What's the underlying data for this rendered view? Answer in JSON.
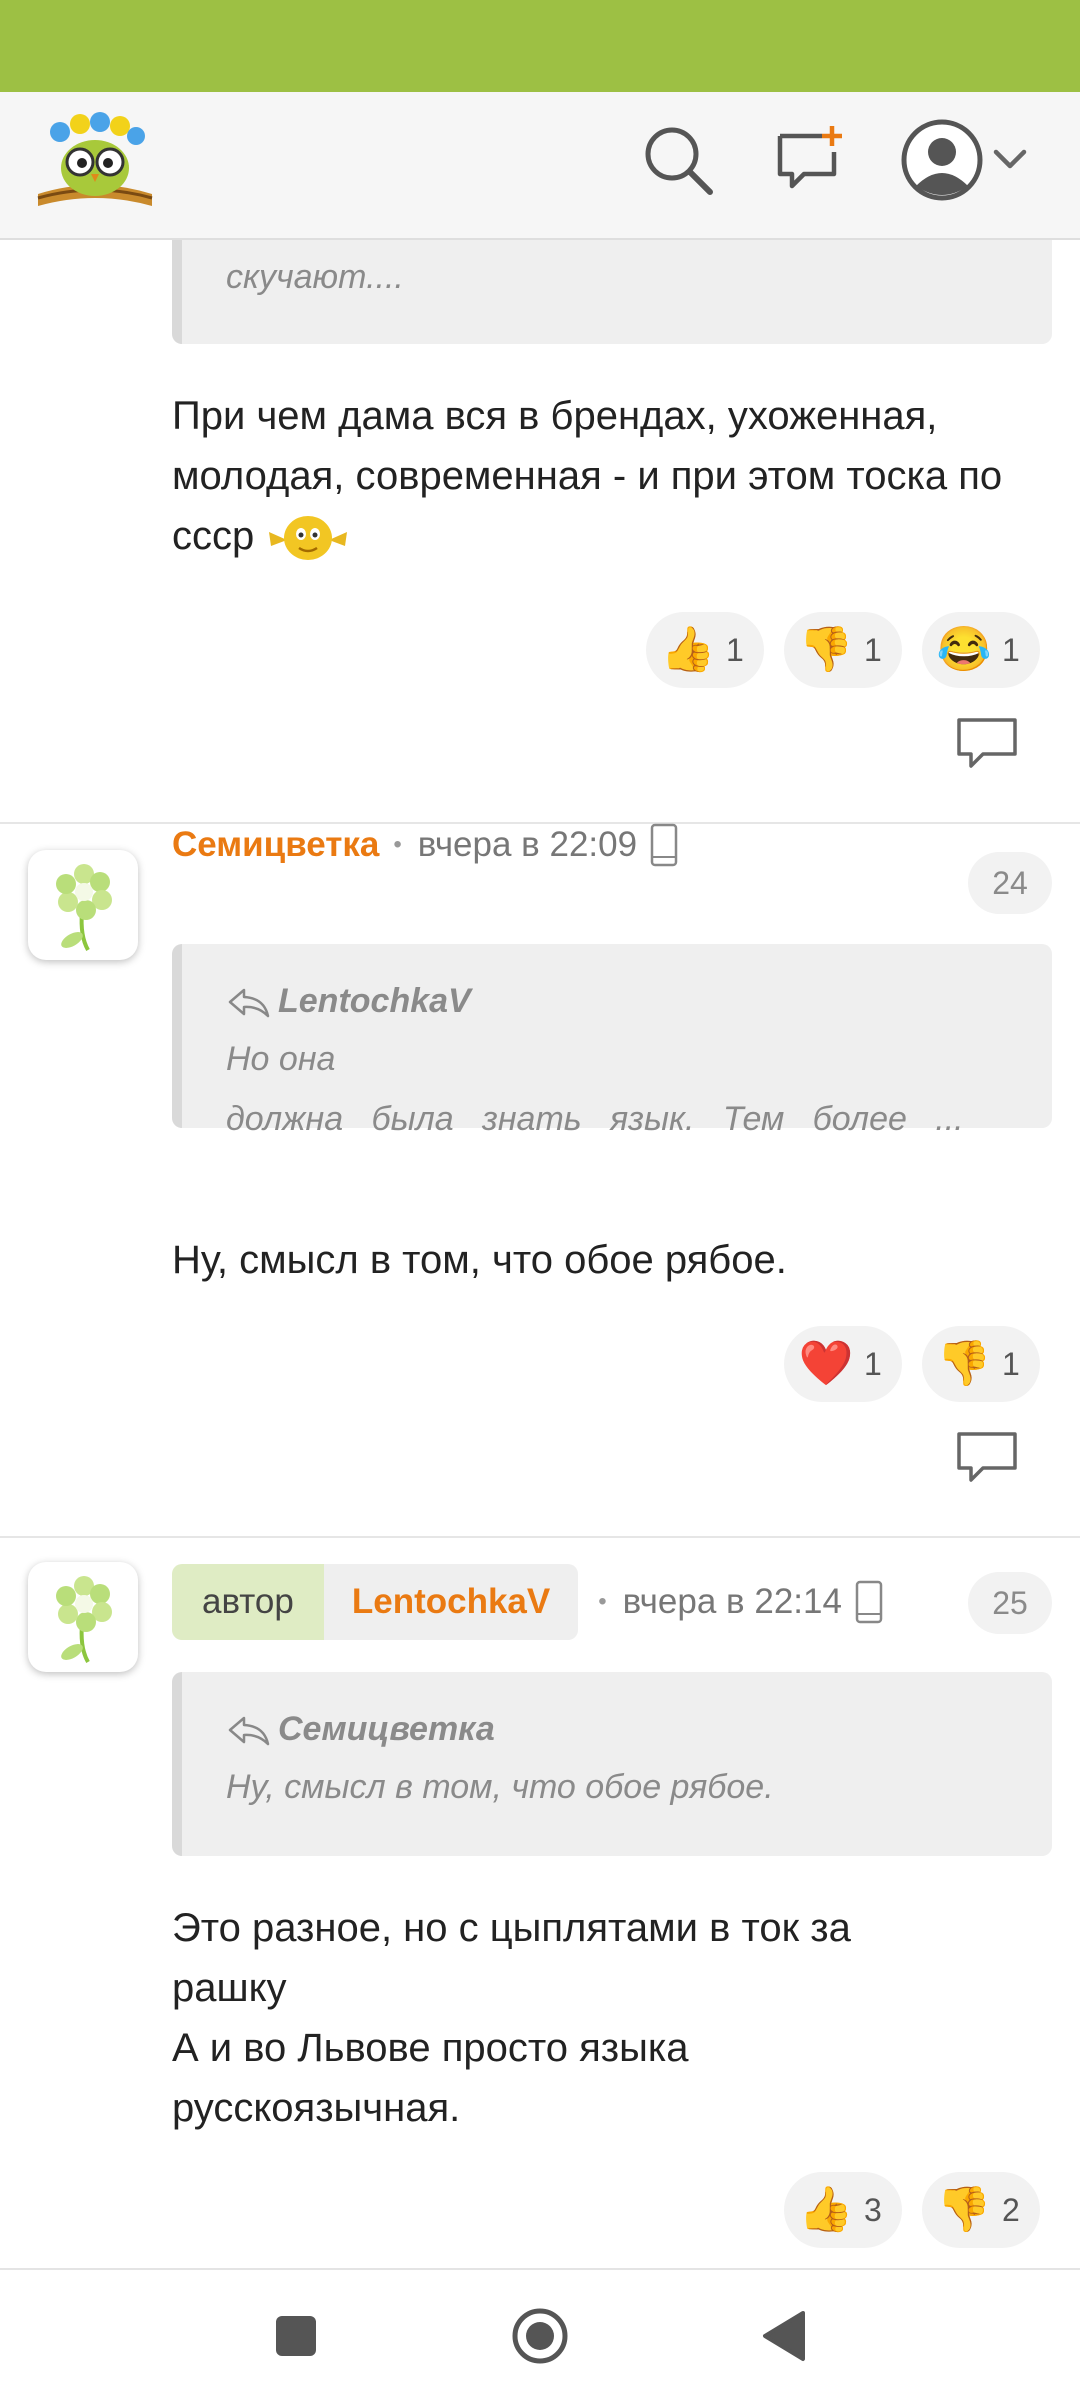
{
  "colors": {
    "status_bar": "#9dc044",
    "accent_orange": "#ea7a12",
    "author_tag_bg": "#dfecc4"
  },
  "header": {
    "logo": "owl-book-logo",
    "icons": [
      "search-icon",
      "new-post-icon",
      "user-avatar-icon",
      "chevron-down-icon"
    ]
  },
  "comments": [
    {
      "quote_text": "скучают....",
      "text": "При чем дама вся в брендах, ухоженная, молодая, современная - и при этом тоска по ссср",
      "reactions": [
        {
          "emoji": "👍",
          "count": "1"
        },
        {
          "emoji": "👎",
          "count": "1"
        },
        {
          "emoji": "😂",
          "count": "1"
        }
      ]
    },
    {
      "author": "Семицветка",
      "time": "вчера в 22:09",
      "number": "24",
      "quote_author": "LentochkaV",
      "quote_lines": [
        "Но она",
        "должна   была   знать   язык.   Тем   более   ..."
      ],
      "text": "Ну, смысл в том, что обое рябое.",
      "reactions": [
        {
          "emoji": "❤️",
          "count": "1"
        },
        {
          "emoji": "👎",
          "count": "1"
        }
      ]
    },
    {
      "author_tag": "автор",
      "author": "LentochkaV",
      "time": "вчера в 22:14",
      "number": "25",
      "quote_author": "Семицветка",
      "quote_lines": [
        "Ну, смысл в том, что обое рябое."
      ],
      "text_lines": [
        "Это разное, но с цыплятами в ток за",
        "рашку",
        "А и во Львове просто языка",
        "русскоязычная."
      ],
      "reactions": [
        {
          "emoji": "👍",
          "count": "3"
        },
        {
          "emoji": "👎",
          "count": "2"
        }
      ]
    }
  ],
  "nav": [
    "square-icon",
    "home-circle-icon",
    "back-triangle-icon"
  ]
}
